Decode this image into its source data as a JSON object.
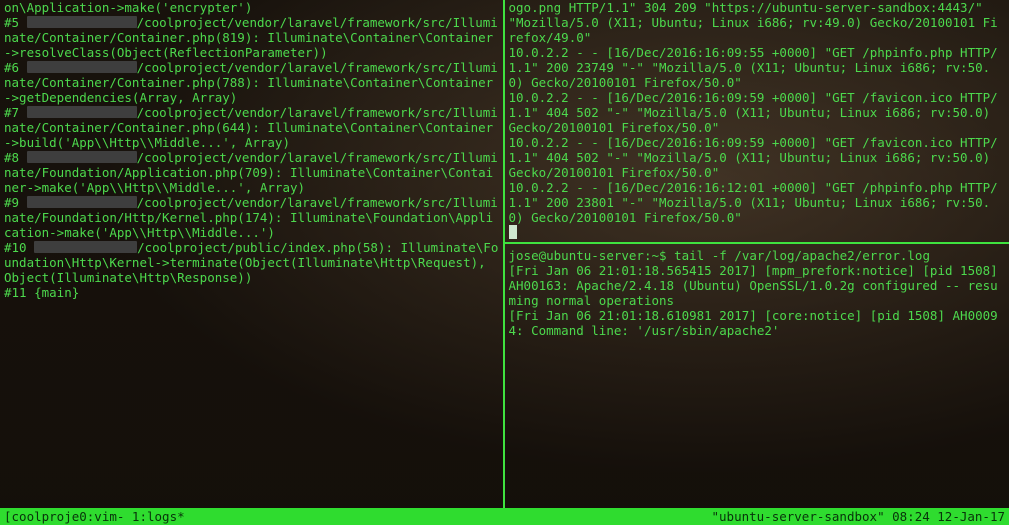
{
  "left_pane": {
    "lines": [
      {
        "t": "on\\Application->make('encrypter')"
      },
      {
        "prefix": "#5 ",
        "redact_w": 110,
        "suffix": "/coolproject/vendor/laravel/framework/src/Illuminate/Container/Container.php(819): Illuminate\\Container\\Container->resolveClass(Object(ReflectionParameter))"
      },
      {
        "prefix": "#6 ",
        "redact_w": 110,
        "suffix": "/coolproject/vendor/laravel/framework/src/Illuminate/Container/Container.php(788): Illuminate\\Container\\Container->getDependencies(Array, Array)"
      },
      {
        "prefix": "#7 ",
        "redact_w": 110,
        "suffix": "/coolproject/vendor/laravel/framework/src/Illuminate/Container/Container.php(644): Illuminate\\Container\\Container->build('App\\\\Http\\\\Middle...', Array)"
      },
      {
        "prefix": "#8 ",
        "redact_w": 110,
        "suffix": "/coolproject/vendor/laravel/framework/src/Illuminate/Foundation/Application.php(709): Illuminate\\Container\\Container->make('App\\\\Http\\\\Middle...', Array)"
      },
      {
        "prefix": "#9 ",
        "redact_w": 110,
        "suffix": "/coolproject/vendor/laravel/framework/src/Illuminate/Foundation/Http/Kernel.php(174): Illuminate\\Foundation\\Application->make('App\\\\Http\\\\Middle...')"
      },
      {
        "prefix": "#10 ",
        "redact_w": 103,
        "suffix": "/coolproject/public/index.php(58): Illuminate\\Foundation\\Http\\Kernel->terminate(Object(Illuminate\\Http\\Request), Object(Illuminate\\Http\\Response))"
      },
      {
        "t": "#11 {main}"
      }
    ]
  },
  "right_top": {
    "lines": [
      "ogo.png HTTP/1.1\" 304 209 \"https://ubuntu-server-sandbox:4443/\" \"Mozilla/5.0 (X11; Ubuntu; Linux i686; rv:49.0) Gecko/20100101 Firefox/49.0\"",
      "10.0.2.2 - - [16/Dec/2016:16:09:55 +0000] \"GET /phpinfo.php HTTP/1.1\" 200 23749 \"-\" \"Mozilla/5.0 (X11; Ubuntu; Linux i686; rv:50.0) Gecko/20100101 Firefox/50.0\"",
      "10.0.2.2 - - [16/Dec/2016:16:09:59 +0000] \"GET /favicon.ico HTTP/1.1\" 404 502 \"-\" \"Mozilla/5.0 (X11; Ubuntu; Linux i686; rv:50.0) Gecko/20100101 Firefox/50.0\"",
      "10.0.2.2 - - [16/Dec/2016:16:09:59 +0000] \"GET /favicon.ico HTTP/1.1\" 404 502 \"-\" \"Mozilla/5.0 (X11; Ubuntu; Linux i686; rv:50.0) Gecko/20100101 Firefox/50.0\"",
      "10.0.2.2 - - [16/Dec/2016:16:12:01 +0000] \"GET /phpinfo.php HTTP/1.1\" 200 23801 \"-\" \"Mozilla/5.0 (X11; Ubuntu; Linux i686; rv:50.0) Gecko/20100101 Firefox/50.0\""
    ]
  },
  "right_bottom": {
    "prompt_user": "jose@ubuntu-server",
    "prompt_path": "~",
    "command": "tail -f /var/log/apache2/error.log",
    "lines": [
      "[Fri Jan 06 21:01:18.565415 2017] [mpm_prefork:notice] [pid 1508] AH00163: Apache/2.4.18 (Ubuntu) OpenSSL/1.0.2g configured -- resuming normal operations",
      "[Fri Jan 06 21:01:18.610981 2017] [core:notice] [pid 1508] AH00094: Command line: '/usr/sbin/apache2'"
    ]
  },
  "statusbar": {
    "left": "[coolproje0:vim- 1:logs*",
    "right": "\"ubuntu-server-sandbox\" 08:24 12-Jan-17"
  },
  "colors": {
    "fg": "#4dd94d",
    "status_bg": "#2fdc2f",
    "status_fg": "#08330a"
  }
}
